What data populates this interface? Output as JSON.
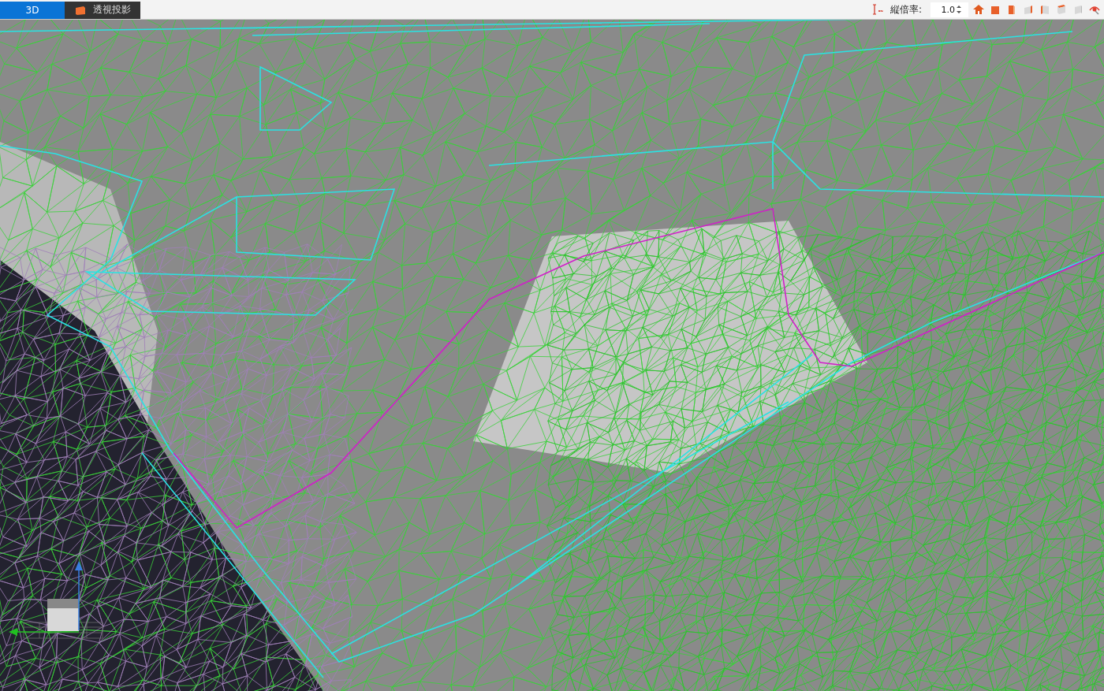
{
  "tabs": [
    {
      "label": "3D",
      "selected": true
    },
    {
      "label": "透視投影",
      "selected": false
    }
  ],
  "toolbar": {
    "scale_label": "縦倍率:",
    "scale_value": "1.0"
  }
}
